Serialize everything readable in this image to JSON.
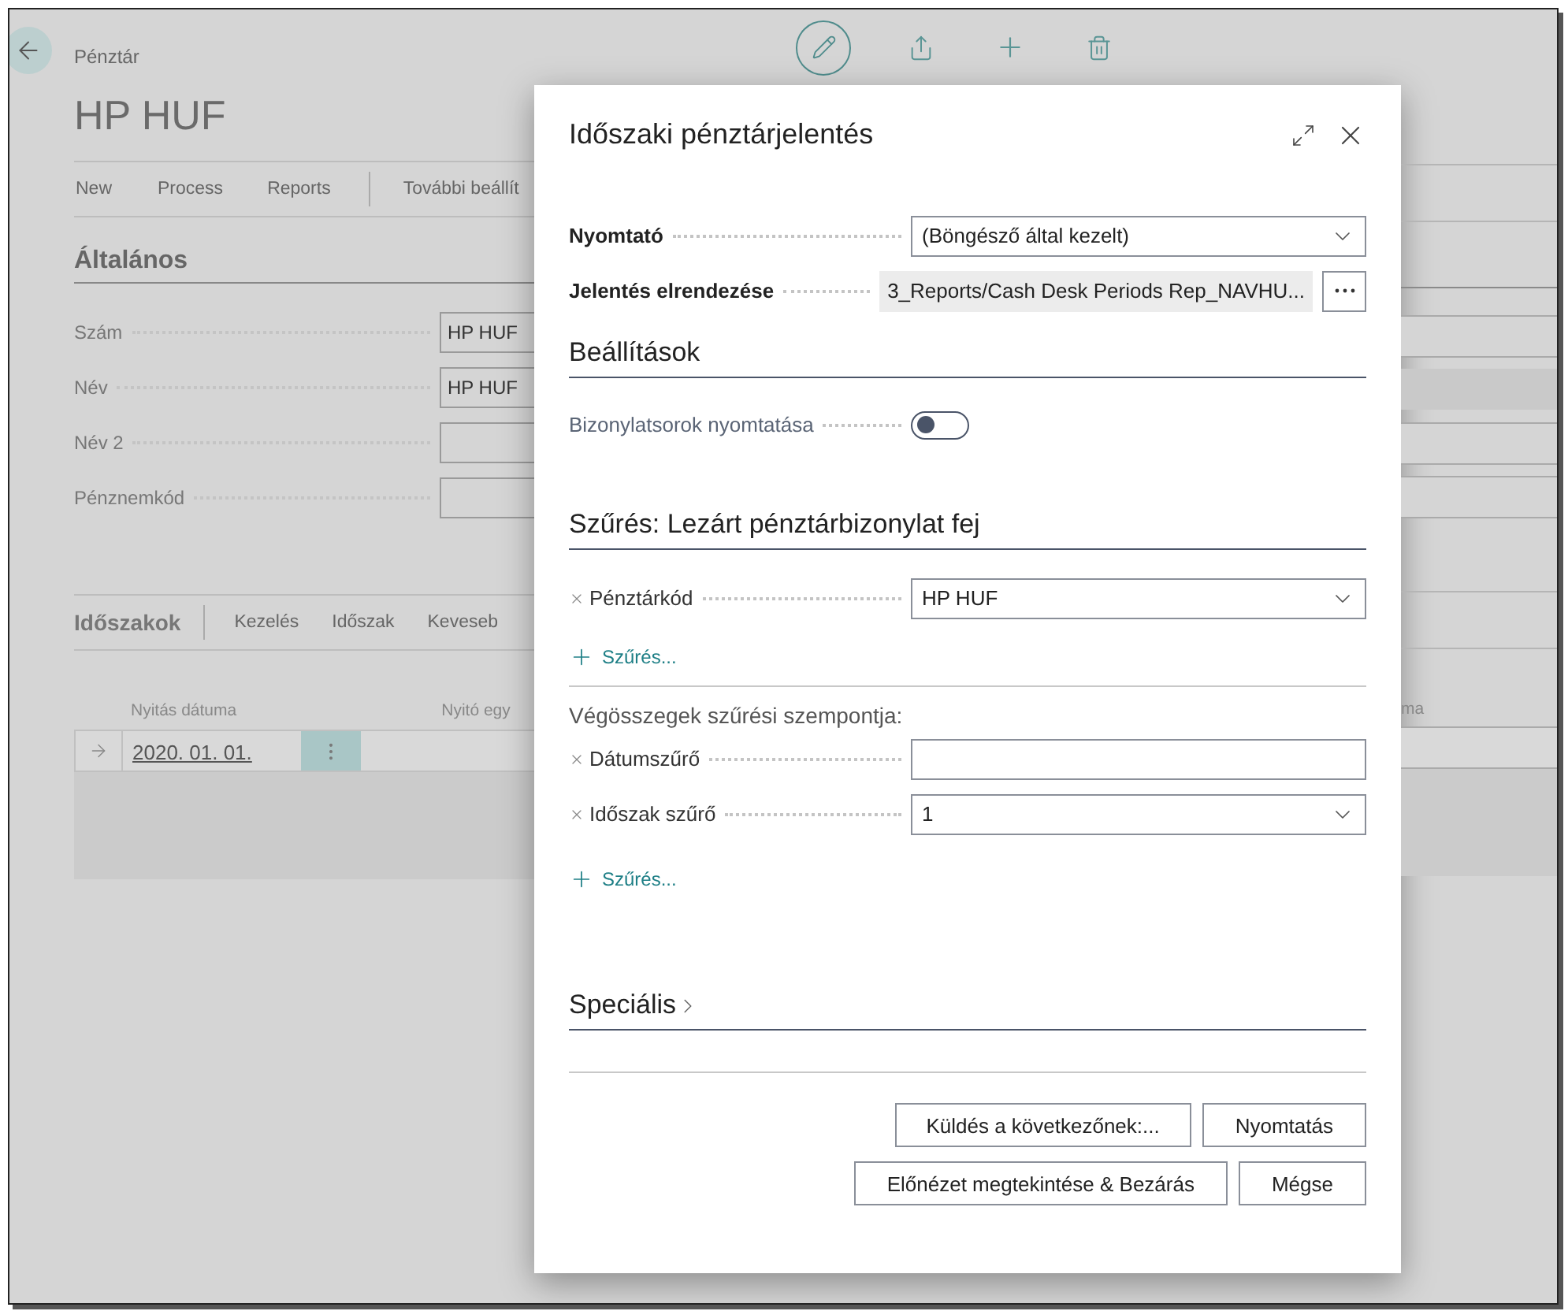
{
  "page": {
    "breadcrumb": "Pénztár",
    "title": "HP HUF",
    "action_bar": [
      "New",
      "Process",
      "Reports",
      "További beállít"
    ],
    "general": {
      "heading": "Általános",
      "fields": [
        {
          "label": "Szám",
          "value": "HP HUF"
        },
        {
          "label": "Név",
          "value": "HP HUF"
        },
        {
          "label": "Név 2"
        },
        {
          "label": "Pénznemkód"
        }
      ]
    },
    "periods": {
      "heading": "Időszakok",
      "actions": [
        "Kezelés",
        "Időszak",
        "Keveseb"
      ],
      "columns": [
        "Nyitás dátuma",
        "Nyitó egy",
        "ma"
      ],
      "rows": [
        {
          "date": "2020. 01. 01."
        }
      ]
    }
  },
  "dialog": {
    "title": "Időszaki pénztárjelentés",
    "options": [
      {
        "kind": "select",
        "label": "Nyomtató",
        "value": "(Böngésző által kezelt)"
      },
      {
        "kind": "lookup",
        "label": "Jelentés elrendezése",
        "value": "3_Reports/Cash Desk Periods Rep_NAVHU..."
      }
    ],
    "settings": {
      "heading": "Beállítások",
      "fields": [
        {
          "kind": "toggle",
          "label": "Bizonylatsorok nyomtatása",
          "on": false
        }
      ]
    },
    "filter": {
      "heading": "Szűrés: Lezárt pénztárbizonylat fej",
      "fields": [
        {
          "kind": "select",
          "label": "Pénztárkód",
          "value": "HP HUF"
        }
      ],
      "add_filter": "Szűrés..."
    },
    "totals": {
      "heading": "Végösszegek szűrési szempontja:",
      "fields": [
        {
          "kind": "input",
          "label": "Dátumszűrő"
        },
        {
          "kind": "select",
          "label": "Időszak szűrő",
          "value": "1"
        }
      ],
      "add_filter": "Szűrés..."
    },
    "special": {
      "heading": "Speciális",
      "expanded": false
    },
    "buttons": [
      [
        "Küldés a következőnek:...",
        "Nyomtatás"
      ],
      [
        "Előnézet megtekintése & Bezárás",
        "Mégse"
      ]
    ]
  }
}
